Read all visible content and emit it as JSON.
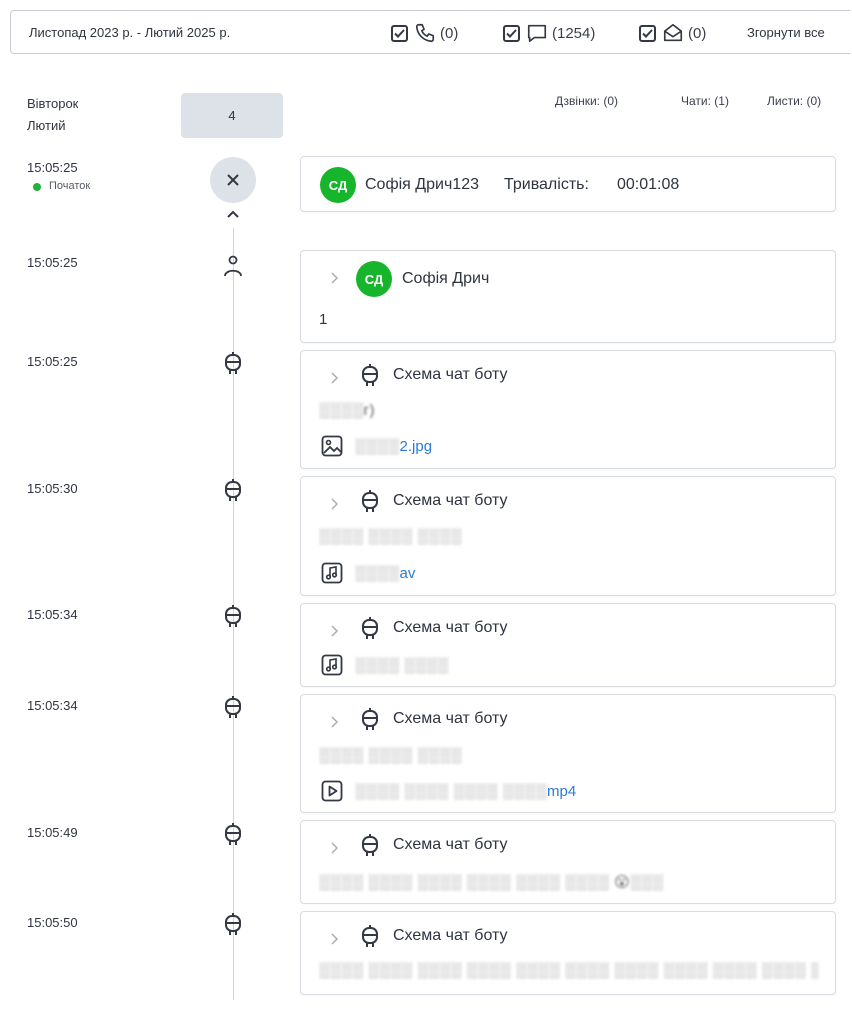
{
  "topbar": {
    "period": "Листопад 2023 р. - Лютий 2025 р.",
    "calls_count": "(0)",
    "chats_count": "(1254)",
    "mails_count": "(0)",
    "collapse_label": "Згорнути все"
  },
  "day": {
    "weekday": "Вівторок",
    "month": "Лютий",
    "count": "4"
  },
  "stats": {
    "calls": "Дзвінки: (0)",
    "chats": "Чати: (1)",
    "mails": "Листи: (0)"
  },
  "session": {
    "time": "15:05:25",
    "start_label": "Початок",
    "avatar": "СД",
    "name": "Софія Дрич123",
    "duration_label": "Тривалість:",
    "duration": "00:01:08"
  },
  "events": [
    {
      "time": "15:05:25",
      "icon": "user-icon",
      "sender": "Софія Дрич",
      "avatar": "СД",
      "text": "1"
    },
    {
      "time": "15:05:25",
      "icon": "bot-icon",
      "sender": "Схема чат боту",
      "text": "░░░░г)",
      "attachment_icon": "image-icon",
      "attachment_blur": "░░░░",
      "attachment_name": "2.jpg"
    },
    {
      "time": "15:05:30",
      "icon": "bot-icon",
      "sender": "Схема чат боту",
      "text": "░░░░ ░░░░ ░░░░",
      "attachment_icon": "audio-icon",
      "attachment_blur": "░░░░",
      "attachment_name": "av"
    },
    {
      "time": "15:05:34",
      "icon": "bot-icon",
      "sender": "Схема чат боту",
      "attachment_icon": "audio-icon",
      "attachment_blur": "░░░░ ░░░░"
    },
    {
      "time": "15:05:34",
      "icon": "bot-icon",
      "sender": "Схема чат боту",
      "text": "░░░░ ░░░░ ░░░░",
      "attachment_icon": "video-icon",
      "attachment_blur": "░░░░ ░░░░ ░░░░ ░░░░",
      "attachment_name": "mp4"
    },
    {
      "time": "15:05:49",
      "icon": "bot-icon",
      "sender": "Схема чат боту",
      "text": "░░░░ ░░░░ ░░░░ ░░░░ ░░░░ ░░░░ 😮░░░"
    },
    {
      "time": "15:05:50",
      "icon": "bot-icon",
      "sender": "Схема чат боту",
      "text": "░░░░ ░░░░ ░░░░ ░░░░ ░░░░ ░░░░ ░░░░ ░░░░ ░░░░ ░░░░ ░░░..."
    }
  ],
  "colors": {
    "avatar": "#16b52b",
    "link": "#2b7bd6",
    "start_dot": "#21b23a"
  }
}
